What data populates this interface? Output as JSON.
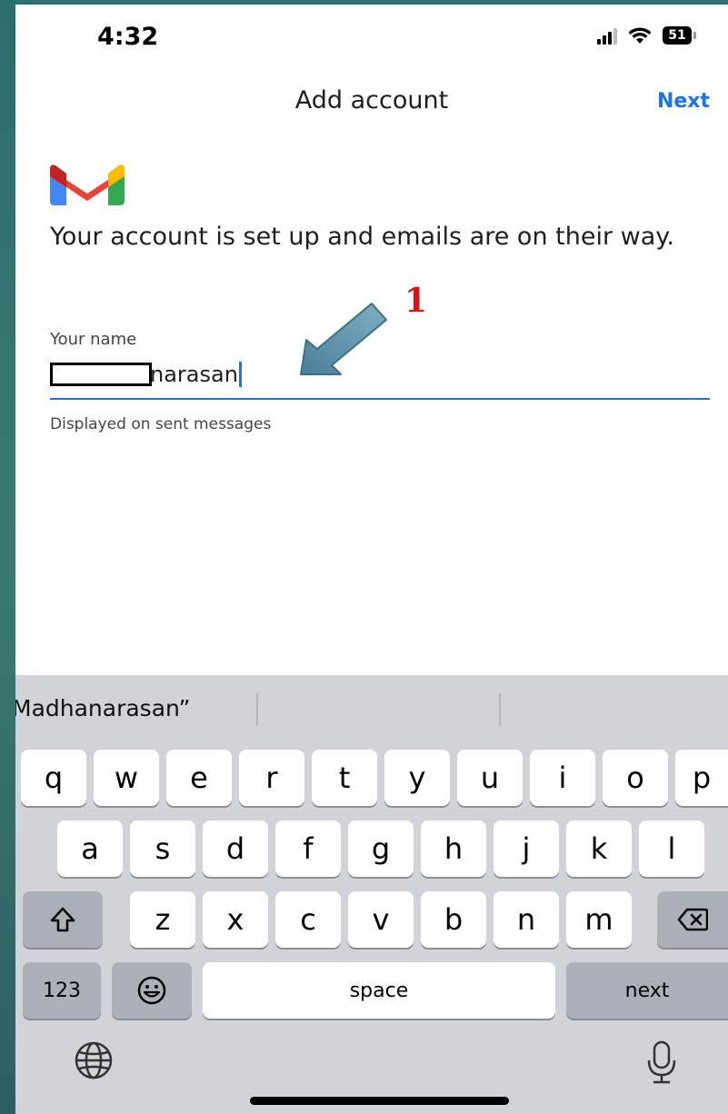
{
  "status_bar": {
    "time": "4:32",
    "battery": "51"
  },
  "nav": {
    "title": "Add account",
    "next_label": "Next"
  },
  "logo": {
    "icon": "gmail-logo",
    "colors": [
      "#4285F4",
      "#EA4335",
      "#FBBC04",
      "#34A853",
      "#C5221F"
    ]
  },
  "headline": "Your account is set up and emails are on their way.",
  "name_field": {
    "label": "Your name",
    "value_visible": "narasan",
    "helper": "Displayed on sent messages"
  },
  "annotation": {
    "number": "1",
    "color": "#d7141a",
    "arrow_color": "#5d8fa8"
  },
  "keyboard": {
    "suggestion": "Madhanarasan”",
    "row1": [
      "q",
      "w",
      "e",
      "r",
      "t",
      "y",
      "u",
      "i",
      "o",
      "p"
    ],
    "row2": [
      "a",
      "s",
      "d",
      "f",
      "g",
      "h",
      "j",
      "k",
      "l"
    ],
    "row3": [
      "z",
      "x",
      "c",
      "v",
      "b",
      "n",
      "m"
    ],
    "numbers_label": "123",
    "space_label": "space",
    "return_label": "next"
  },
  "accent_color": "#1a73e8"
}
